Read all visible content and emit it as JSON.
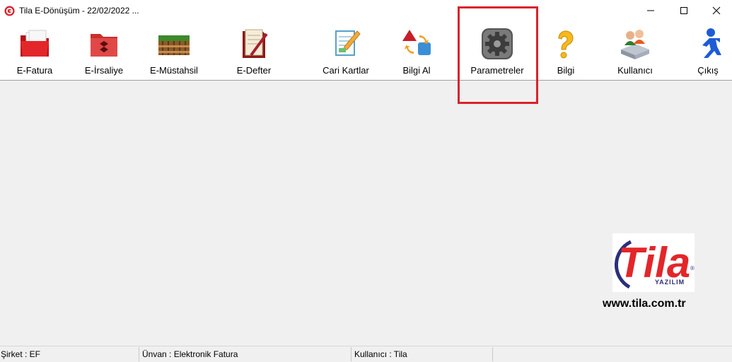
{
  "window": {
    "title": "Tila E-Dönüşüm - 22/02/2022 ...",
    "controls": {
      "minimize": "–",
      "maximize": "☐",
      "close": "✕"
    }
  },
  "toolbar": {
    "items": [
      {
        "label": "E-Fatura",
        "icon": "red-folder-icon"
      },
      {
        "label": "E-İrsaliye",
        "icon": "red-dropbox-folder-icon"
      },
      {
        "label": "E-Müstahsil",
        "icon": "farm-fence-icon"
      },
      {
        "label": "E-Defter",
        "icon": "ledger-book-icon"
      },
      {
        "label": "Cari Kartlar",
        "icon": "edit-document-icon"
      },
      {
        "label": "Bilgi Al",
        "icon": "shapes-sync-icon"
      },
      {
        "label": "Parametreler",
        "icon": "gear-icon"
      },
      {
        "label": "Bilgi",
        "icon": "question-mark-icon"
      },
      {
        "label": "Kullanıcı",
        "icon": "users-icon"
      },
      {
        "label": "Çıkış",
        "icon": "running-man-icon"
      }
    ]
  },
  "logo": {
    "brand": "Tila",
    "sub": "YAZILIM",
    "website": "www.tila.com.tr"
  },
  "statusbar": {
    "company": "Şirket : EF",
    "title": "Ünvan : Elektronik Fatura",
    "user": "Kullanıcı : Tila"
  },
  "colors": {
    "accent_red": "#d9232d",
    "logo_red": "#e3262a",
    "logo_navy": "#2b2f7a"
  }
}
